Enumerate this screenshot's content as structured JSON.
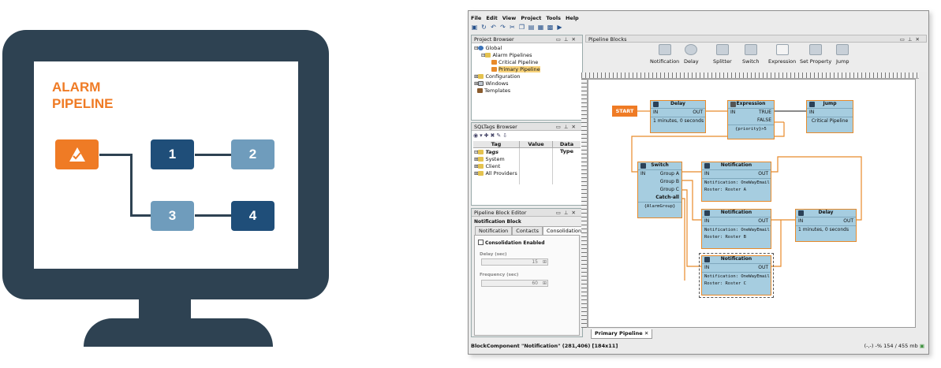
{
  "illustration": {
    "title_line1": "ALARM",
    "title_line2": "PIPELINE",
    "boxes": [
      {
        "label": "",
        "icon": "alarm-warning-icon",
        "color": "#ef7b25"
      },
      {
        "label": "1",
        "color": "#1f4e79"
      },
      {
        "label": "2",
        "color": "#6f9cbc"
      },
      {
        "label": "3",
        "color": "#6f9cbc"
      },
      {
        "label": "4",
        "color": "#1f4e79"
      }
    ],
    "colors": {
      "monitor": "#2e4252",
      "accent": "#ef7b25"
    }
  },
  "app": {
    "menu": [
      "File",
      "Edit",
      "View",
      "Project",
      "Tools",
      "Help"
    ],
    "project_browser": {
      "title": "Project Browser",
      "items": [
        "Global",
        "Alarm Pipelines",
        "Critical Pipeline",
        "Primary Pipeline",
        "Configuration",
        "Windows",
        "Templates"
      ]
    },
    "sqltags_browser": {
      "title": "SQLTags Browser",
      "columns": [
        "Tag",
        "Value",
        "Data Type"
      ],
      "items": [
        "Tags",
        "System",
        "Client",
        "All Providers"
      ]
    },
    "block_editor": {
      "title": "Pipeline Block Editor",
      "subtitle": "Notification Block",
      "tabs": [
        "Notification",
        "Contacts",
        "Consolidation"
      ],
      "checkbox_label": "Consolidation Enabled",
      "delay_label": "Delay (sec)",
      "delay_value": "15",
      "frequency_label": "Frequency (sec)",
      "frequency_value": "60"
    },
    "pipeline_blocks": {
      "title": "Pipeline Blocks",
      "palette": [
        "Notification",
        "Delay",
        "Splitter",
        "Switch",
        "Expression",
        "Set Property",
        "Jump"
      ]
    },
    "canvas": {
      "start_label": "START",
      "port_in": "IN",
      "port_out": "OUT",
      "delay1": {
        "title": "Delay",
        "detail": "1 minutes, 0 seconds"
      },
      "expression": {
        "title": "Expression",
        "true_label": "TRUE",
        "false_label": "FALSE",
        "expr": "{priority}>5"
      },
      "jump": {
        "title": "Jump",
        "target": "Critical Pipeline"
      },
      "switch": {
        "title": "Switch",
        "groups": [
          "Group A",
          "Group B",
          "Group C",
          "Catch-all"
        ],
        "expr": "{AlarmGroup}"
      },
      "notif_a": {
        "title": "Notification",
        "line1": "Notification: OneWayEmail",
        "line2": "Roster: Roster A"
      },
      "notif_b": {
        "title": "Notification",
        "line1": "Notification: OneWayEmail",
        "line2": "Roster: Roster B"
      },
      "notif_c": {
        "title": "Notification",
        "line1": "Notification: OneWayEmail",
        "line2": "Roster: Roster C"
      },
      "delay2": {
        "title": "Delay",
        "detail": "1 minutes, 0 seconds"
      }
    },
    "bottom_tab": "Primary Pipeline",
    "status_left": "BlockComponent \"Notification\" (281,406) [184x11]",
    "status_right": "-%  154 / 455 mb"
  }
}
